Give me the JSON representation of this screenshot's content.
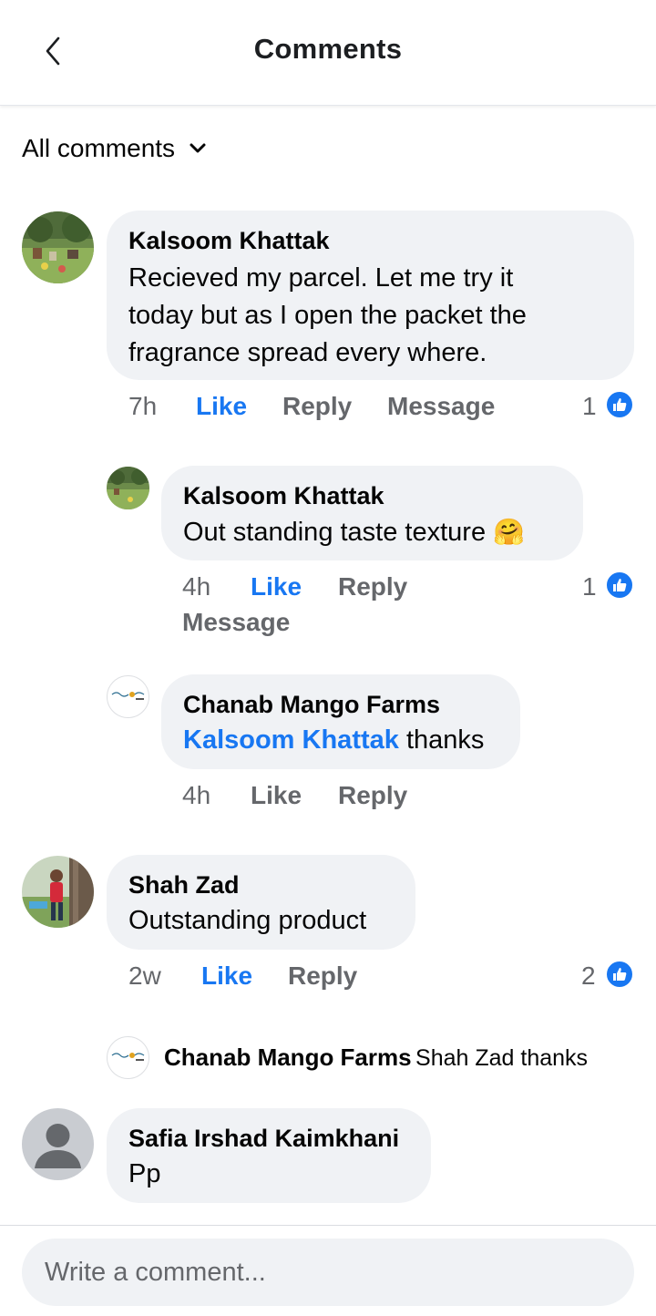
{
  "header": {
    "title": "Comments"
  },
  "filter": {
    "label": "All comments"
  },
  "colors": {
    "accent": "#1877f2",
    "bubble": "#f0f2f5",
    "muted": "#65676b"
  },
  "comments": [
    {
      "author": "Kalsoom Khattak",
      "lines": [
        "Recieved my parcel. Let me try it",
        "today but as I open the packet the",
        "fragrance spread every where."
      ],
      "time": "7h",
      "like": "Like",
      "reply": "Reply",
      "message": "Message",
      "reactions": "1"
    },
    {
      "author": "Kalsoom Khattak",
      "text": "Out standing taste texture",
      "emoji": "🤗",
      "time": "4h",
      "like": "Like",
      "reply": "Reply",
      "message": "Message",
      "reactions": "1"
    },
    {
      "author": "Chanab Mango Farms",
      "mention": "Kalsoom Khattak",
      "text": " thanks",
      "time": "4h",
      "like": "Like",
      "reply": "Reply"
    },
    {
      "author": "Shah Zad",
      "text": "Outstanding product",
      "time": "2w",
      "like": "Like",
      "reply": "Reply",
      "reactions": "2"
    },
    {
      "author": "Chanab Mango Farms",
      "text": "Shah Zad thanks"
    },
    {
      "author": "Safia Irshad Kaimkhani",
      "text": "Pp"
    }
  ],
  "composer": {
    "placeholder": "Write a comment..."
  },
  "icons": {
    "back": "chevron-left-icon",
    "dropdown": "chevron-down-icon",
    "like": "thumbs-up-icon",
    "avatar_default": "user-silhouette-icon",
    "emoji": "hugging-face-emoji"
  }
}
